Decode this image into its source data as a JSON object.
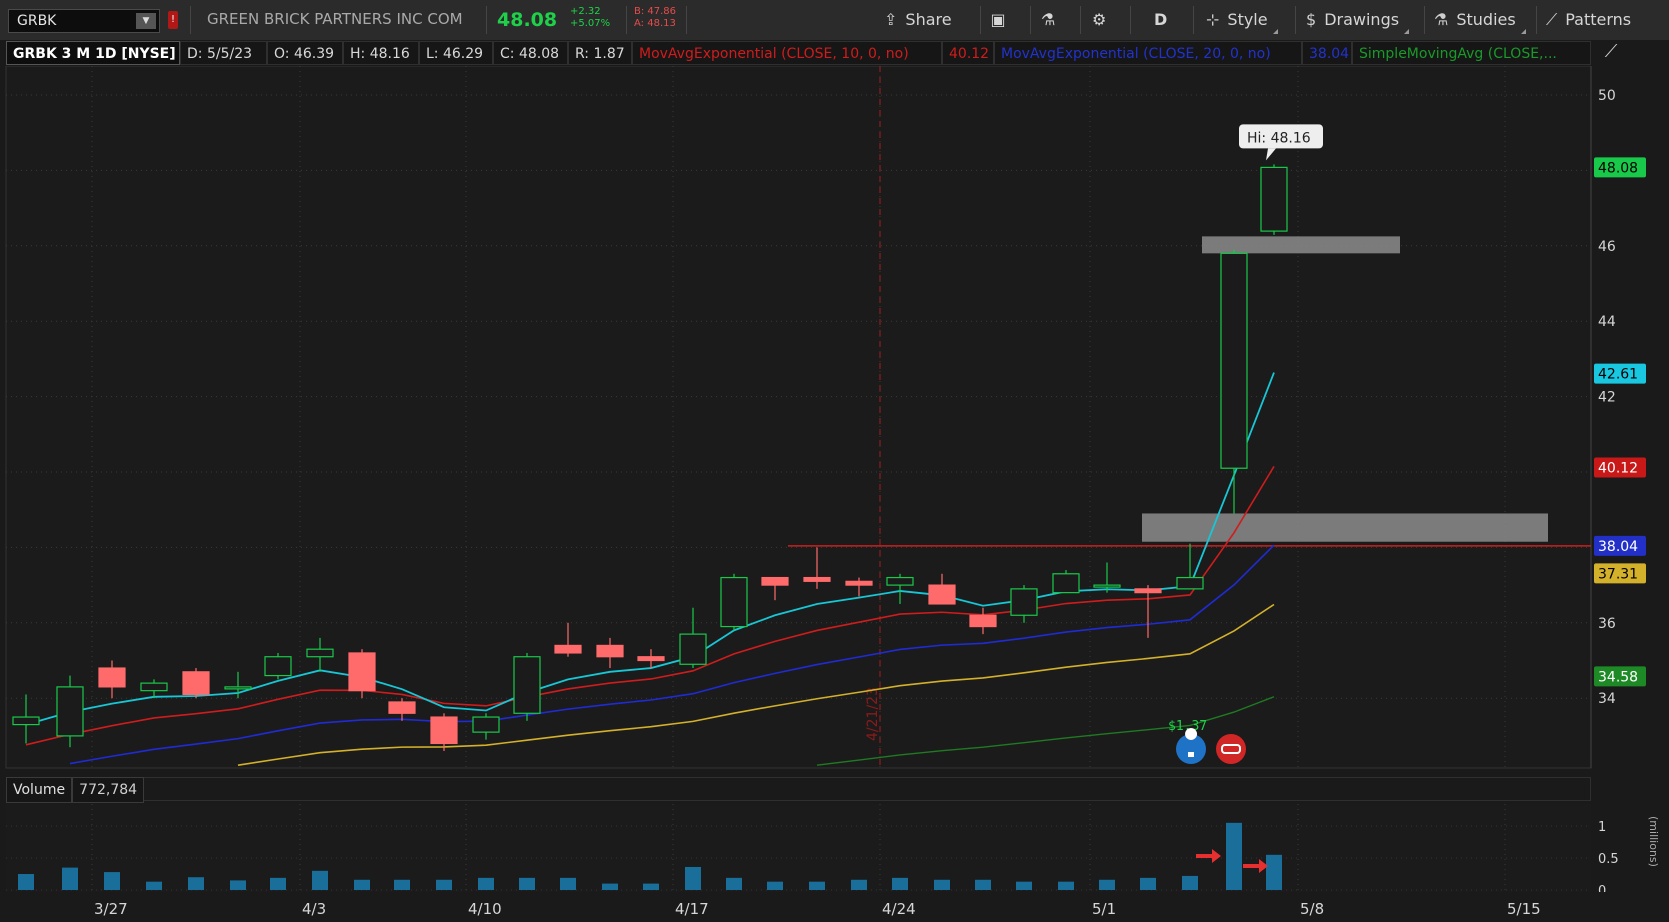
{
  "toolbar": {
    "symbol": "GRBK",
    "company": "GREEN BRICK PARTNERS INC COM",
    "last": "48.08",
    "net_change": "+2.32",
    "pct_change": "+5.07%",
    "bid": "B: 47.86",
    "ask": "A: 48.13",
    "share": "Share",
    "aggregation": "D",
    "style": "Style",
    "drawings": "Drawings",
    "studies": "Studies",
    "patterns": "Patterns"
  },
  "info": {
    "title": "GRBK 3 M 1D [NYSE]",
    "date": "D: 5/5/23",
    "open": "O: 46.39",
    "high": "H: 48.16",
    "low": "L: 46.29",
    "close": "C: 48.08",
    "range": "R: 1.87",
    "ema10_label": "MovAvgExponential (CLOSE, 10, 0, no)",
    "ema10_value": "40.12",
    "ema20_label": "MovAvgExponential (CLOSE, 20, 0, no)",
    "ema20_value": "38.04",
    "sma_label": "SimpleMovingAvg (CLOSE,..."
  },
  "volume": {
    "label": "Volume",
    "value": "772,784",
    "unit": "(millions)",
    "ticks": [
      "1",
      "0.5",
      "0"
    ]
  },
  "colors": {
    "up": "#19c94a",
    "down": "#ff6b6b",
    "ema10": "#d01c1c",
    "ema20": "#1f2bd6",
    "fast": "#17c7d6",
    "sma50": "#d4b12a",
    "sma200": "#1f7a22"
  },
  "chart_data": {
    "type": "candlestick",
    "ylim": [
      32,
      51
    ],
    "yticks": [
      34,
      36,
      38,
      40,
      42,
      44,
      46,
      48,
      50
    ],
    "x_labels": [
      "3/27",
      "4/3",
      "4/10",
      "4/17",
      "4/24",
      "5/1",
      "5/8",
      "5/15"
    ],
    "session_marker": "4/21/23",
    "hi_callout": "Hi: 48.16",
    "event_label": "$1.37",
    "price_flags": [
      {
        "value": "48.08",
        "bg": "#19c94a",
        "fg": "#000000",
        "y": 48.08
      },
      {
        "value": "42.61",
        "bg": "#19c7e0",
        "fg": "#000000",
        "y": 42.61
      },
      {
        "value": "40.12",
        "bg": "#c81818",
        "fg": "#ffffff",
        "y": 40.12
      },
      {
        "value": "38.04",
        "bg": "#2230c8",
        "fg": "#ffffff",
        "y": 38.04
      },
      {
        "value": "37.31",
        "bg": "#d4b12a",
        "fg": "#000000",
        "y": 37.31
      },
      {
        "value": "34.58",
        "bg": "#1e8a26",
        "fg": "#ffffff",
        "y": 34.58
      }
    ],
    "candles": [
      {
        "o": 33.3,
        "c": 33.5,
        "h": 34.1,
        "l": 32.8
      },
      {
        "o": 33.0,
        "c": 34.3,
        "h": 34.6,
        "l": 32.7
      },
      {
        "o": 34.8,
        "c": 34.3,
        "h": 35.0,
        "l": 34.0
      },
      {
        "o": 34.2,
        "c": 34.4,
        "h": 34.5,
        "l": 34.0
      },
      {
        "o": 34.7,
        "c": 34.1,
        "h": 34.8,
        "l": 34.0
      },
      {
        "o": 34.3,
        "c": 34.3,
        "h": 34.7,
        "l": 34.0
      },
      {
        "o": 34.6,
        "c": 35.1,
        "h": 35.2,
        "l": 34.5
      },
      {
        "o": 35.1,
        "c": 35.3,
        "h": 35.6,
        "l": 34.7
      },
      {
        "o": 35.2,
        "c": 34.2,
        "h": 35.3,
        "l": 34.0
      },
      {
        "o": 33.9,
        "c": 33.6,
        "h": 34.0,
        "l": 33.4
      },
      {
        "o": 33.5,
        "c": 32.8,
        "h": 33.6,
        "l": 32.6
      },
      {
        "o": 33.1,
        "c": 33.5,
        "h": 33.6,
        "l": 32.9
      },
      {
        "o": 33.6,
        "c": 35.1,
        "h": 35.2,
        "l": 33.4
      },
      {
        "o": 35.4,
        "c": 35.2,
        "h": 36.0,
        "l": 35.1
      },
      {
        "o": 35.4,
        "c": 35.1,
        "h": 35.6,
        "l": 34.8
      },
      {
        "o": 35.1,
        "c": 35.0,
        "h": 35.3,
        "l": 34.8
      },
      {
        "o": 34.9,
        "c": 35.7,
        "h": 36.4,
        "l": 34.8
      },
      {
        "o": 35.9,
        "c": 37.2,
        "h": 37.3,
        "l": 35.8
      },
      {
        "o": 37.2,
        "c": 37.0,
        "h": 37.2,
        "l": 36.6
      },
      {
        "o": 37.2,
        "c": 37.1,
        "h": 38.0,
        "l": 36.9
      },
      {
        "o": 37.1,
        "c": 37.0,
        "h": 37.2,
        "l": 36.7
      },
      {
        "o": 37.0,
        "c": 37.2,
        "h": 37.3,
        "l": 36.5
      },
      {
        "o": 37.0,
        "c": 36.5,
        "h": 37.3,
        "l": 36.5
      },
      {
        "o": 36.2,
        "c": 35.9,
        "h": 36.4,
        "l": 35.7
      },
      {
        "o": 36.2,
        "c": 36.9,
        "h": 37.0,
        "l": 36.0
      },
      {
        "o": 36.8,
        "c": 37.3,
        "h": 37.4,
        "l": 36.8
      },
      {
        "o": 37.0,
        "c": 37.0,
        "h": 37.6,
        "l": 36.8
      },
      {
        "o": 36.9,
        "c": 36.8,
        "h": 37.0,
        "l": 35.6
      },
      {
        "o": 36.9,
        "c": 37.2,
        "h": 38.1,
        "l": 36.9
      },
      {
        "o": 40.1,
        "c": 45.8,
        "h": 45.9,
        "l": 38.9
      },
      {
        "o": 46.39,
        "c": 48.08,
        "h": 48.16,
        "l": 46.29
      }
    ],
    "volumes": [
      0.25,
      0.35,
      0.28,
      0.13,
      0.2,
      0.15,
      0.19,
      0.3,
      0.16,
      0.16,
      0.16,
      0.19,
      0.19,
      0.19,
      0.1,
      0.1,
      0.36,
      0.19,
      0.13,
      0.13,
      0.16,
      0.19,
      0.16,
      0.16,
      0.13,
      0.13,
      0.16,
      0.19,
      0.22,
      1.05,
      0.55
    ]
  }
}
